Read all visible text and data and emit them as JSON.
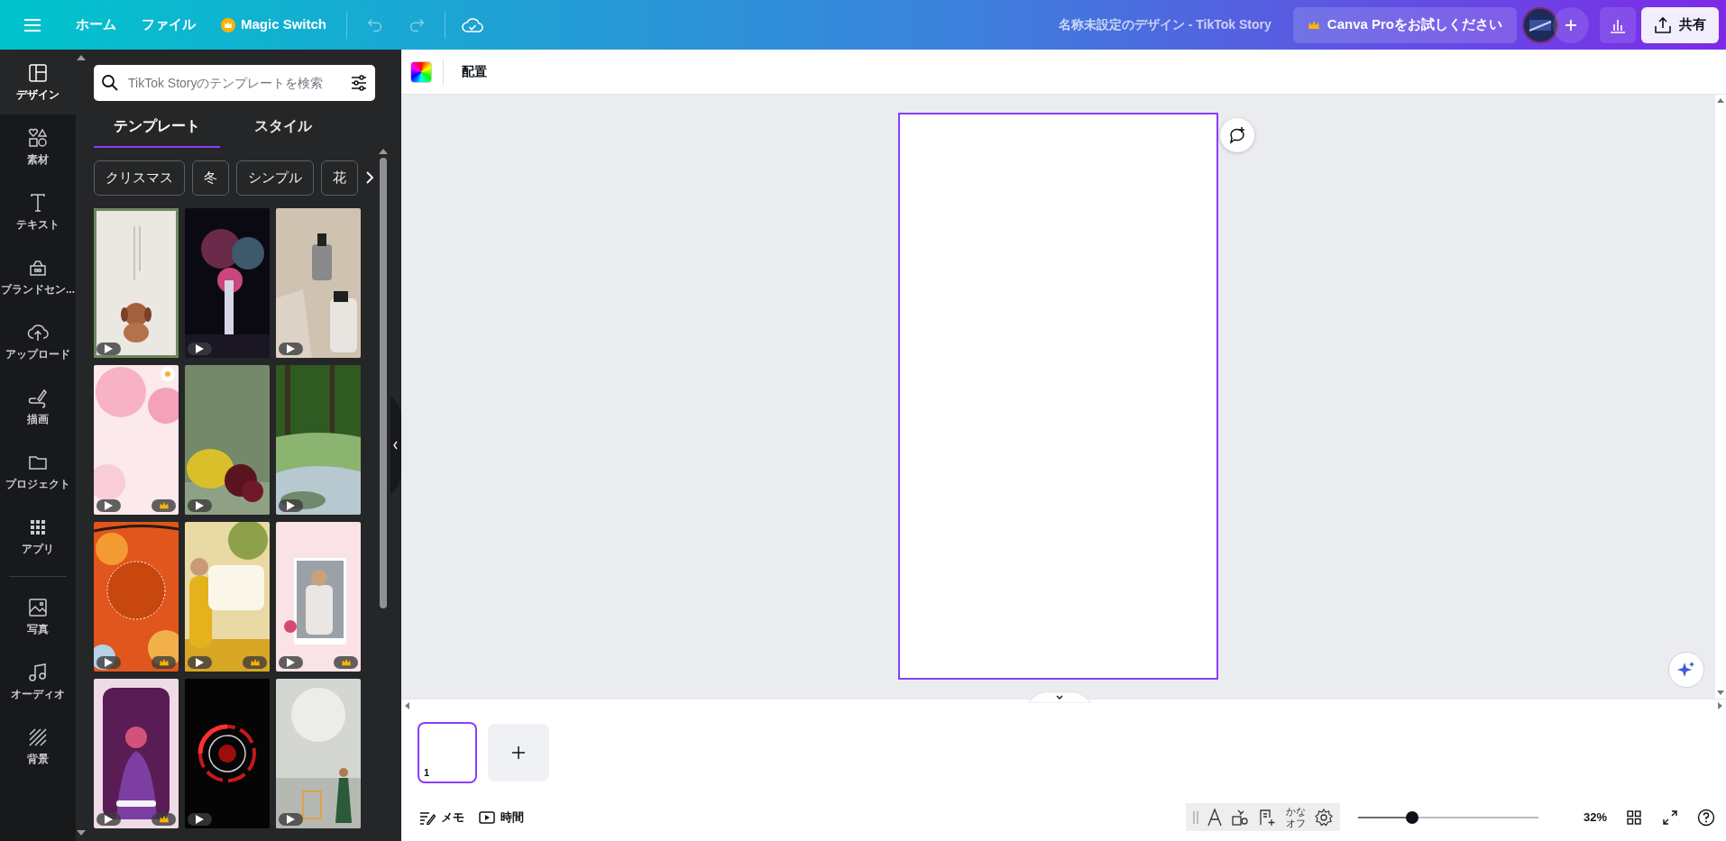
{
  "topbar": {
    "nav": [
      {
        "label": "ホーム",
        "premium": false
      },
      {
        "label": "ファイル",
        "premium": false
      },
      {
        "label": "Magic Switch",
        "premium": true
      }
    ],
    "undo": {
      "disabled": true
    },
    "redo": {
      "disabled": true
    },
    "title": "名称未設定のデザイン - TikTok Story",
    "pro_button": {
      "label": "Canva Proをお試しください",
      "premium": true
    },
    "share_button": "共有"
  },
  "rail": {
    "groups": [
      {
        "items": [
          {
            "label": "デザイン",
            "selected": true
          },
          {
            "label": "素材",
            "selected": false
          },
          {
            "label": "テキスト",
            "selected": false
          },
          {
            "label": "ブランドセン...",
            "selected": false
          },
          {
            "label": "アップロード",
            "selected": false
          },
          {
            "label": "描画",
            "selected": false
          },
          {
            "label": "プロジェクト",
            "selected": false
          },
          {
            "label": "アプリ",
            "selected": false
          }
        ]
      },
      {
        "items": [
          {
            "label": "写真",
            "selected": false
          },
          {
            "label": "オーディオ",
            "selected": false
          },
          {
            "label": "背景",
            "selected": false
          }
        ]
      }
    ]
  },
  "panel": {
    "search": {
      "placeholder": "TikTok Storyのテンプレートを検索"
    },
    "tabs": [
      {
        "label": "テンプレート",
        "selected": true
      },
      {
        "label": "スタイル",
        "selected": false
      }
    ],
    "chips": [
      "クリスマス",
      "冬",
      "シンプル",
      "花"
    ],
    "templates": [
      {
        "premium": false,
        "highlighted": true
      },
      {
        "premium": false,
        "highlighted": false
      },
      {
        "premium": false,
        "highlighted": false
      },
      {
        "premium": true,
        "highlighted": false
      },
      {
        "premium": false,
        "highlighted": false
      },
      {
        "premium": false,
        "highlighted": false
      },
      {
        "premium": true,
        "highlighted": false
      },
      {
        "premium": true,
        "highlighted": false
      },
      {
        "premium": true,
        "highlighted": false
      },
      {
        "premium": true,
        "highlighted": false
      },
      {
        "premium": false,
        "highlighted": false
      },
      {
        "premium": false,
        "highlighted": false
      }
    ]
  },
  "toolbar": {
    "position_button": "配置"
  },
  "pages": [
    {
      "number": "1",
      "selected": true
    }
  ],
  "footer": {
    "notes": "メモ",
    "timer": "時間",
    "kana": "かなオフ",
    "zoom": {
      "level": 0.3,
      "reading": "32%"
    }
  }
}
